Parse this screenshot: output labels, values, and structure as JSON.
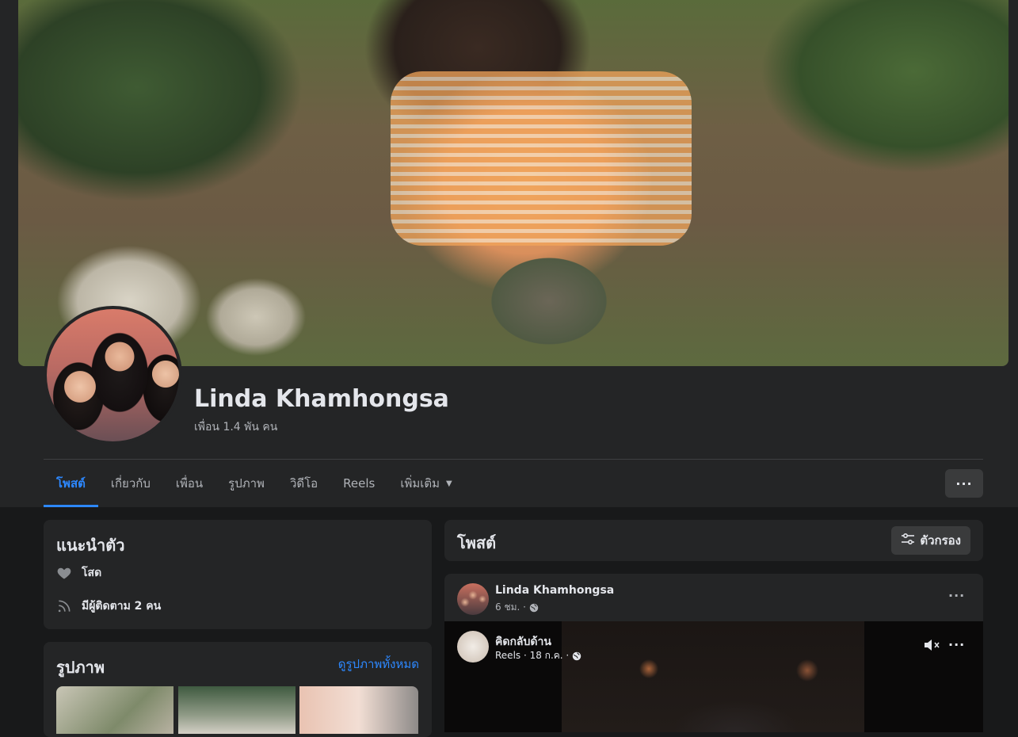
{
  "profile": {
    "name": "Linda Khamhongsa",
    "friends_text": "เพื่อน 1.4 พัน คน"
  },
  "tabs": [
    {
      "label": "โพสต์",
      "active": true
    },
    {
      "label": "เกี่ยวกับ"
    },
    {
      "label": "เพื่อน"
    },
    {
      "label": "รูปภาพ"
    },
    {
      "label": "วิดีโอ"
    },
    {
      "label": "Reels"
    },
    {
      "label": "เพิ่มเติม"
    }
  ],
  "more_button": "···",
  "intro": {
    "title": "แนะนำตัว",
    "relationship": "โสด",
    "followers": "มีผู้ติดตาม 2 คน"
  },
  "photos": {
    "title": "รูปภาพ",
    "see_all": "ดูรูปภาพทั้งหมด"
  },
  "posts": {
    "title": "โพสต์",
    "filter_label": "ตัวกรอง"
  },
  "post": {
    "author": "Linda Khamhongsa",
    "time": "6 ชม. ·",
    "reel": {
      "title": "คิดกลับด้าน",
      "meta": "Reels · 18 ก.ค. ·"
    }
  },
  "colors": {
    "accent": "#2d88ff",
    "surface": "#242526",
    "background": "#18191a",
    "button": "#3a3b3c"
  }
}
